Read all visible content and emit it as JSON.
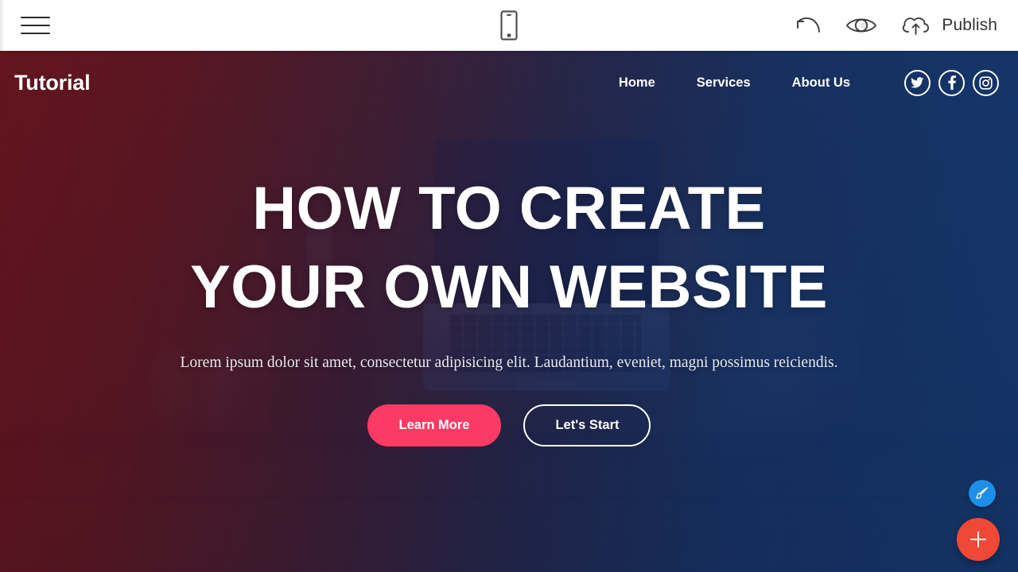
{
  "editor": {
    "menu_icon": "hamburger-menu-icon",
    "device_preview_icon": "mobile-phone-icon",
    "undo_icon": "undo-arrow-icon",
    "preview_icon": "eye-preview-icon",
    "publish_icon": "cloud-upload-icon",
    "publish_label": "Publish"
  },
  "site": {
    "brand": "Tutorial",
    "nav": [
      {
        "label": "Home"
      },
      {
        "label": "Services"
      },
      {
        "label": "About Us"
      }
    ],
    "socials": [
      {
        "name": "twitter-icon"
      },
      {
        "name": "facebook-icon"
      },
      {
        "name": "instagram-icon"
      }
    ]
  },
  "hero": {
    "title_line1": "HOW TO CREATE",
    "title_line2": "YOUR OWN WEBSITE",
    "subtitle": "Lorem ipsum dolor sit amet, consectetur adipisicing elit. Laudantium, eveniet, magni possimus reiciendis.",
    "primary_button": "Learn More",
    "secondary_button": "Let's Start"
  },
  "fabs": {
    "brush_icon": "paintbrush-icon",
    "add_icon": "plus-icon"
  },
  "colors": {
    "accent_pink": "#fb3b64",
    "fab_blue": "#1e8fe8",
    "fab_red": "#ef4836",
    "gradient_start": "#7e121e",
    "gradient_end": "#104692",
    "bar_background": "#ffffff"
  }
}
